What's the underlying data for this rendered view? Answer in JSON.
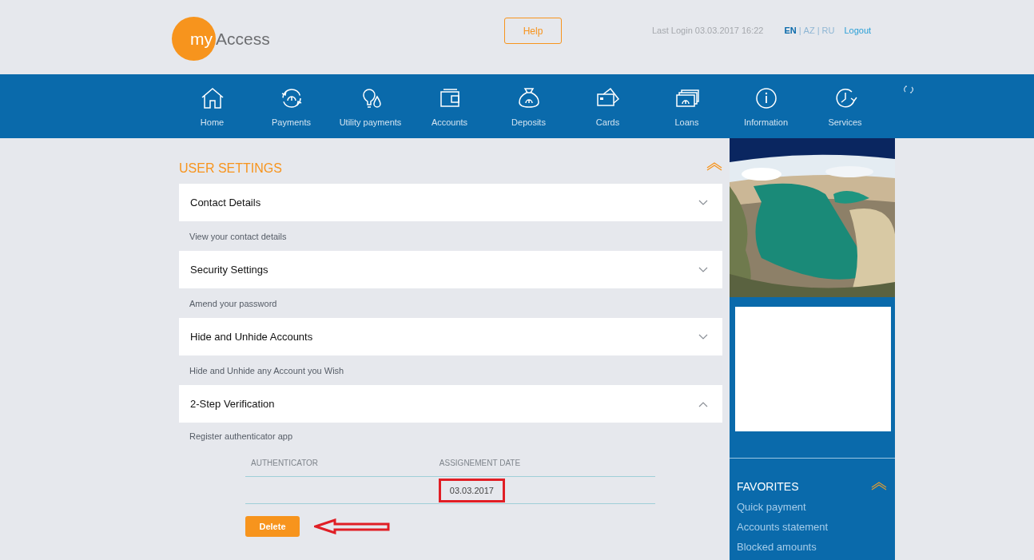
{
  "header": {
    "logo": {
      "prefix": "my",
      "name": "Access"
    },
    "help_button": "Help",
    "last_login": "Last Login 03.03.2017 16:22",
    "languages": {
      "separator": "|",
      "items": [
        {
          "label": "EN",
          "selected": true
        },
        {
          "label": "AZ",
          "selected": false
        },
        {
          "label": "RU",
          "selected": false
        }
      ]
    },
    "logout": "Logout"
  },
  "nav": {
    "items": [
      {
        "label": "Home"
      },
      {
        "label": "Payments"
      },
      {
        "label": "Utility payments"
      },
      {
        "label": "Accounts"
      },
      {
        "label": "Deposits"
      },
      {
        "label": "Cards"
      },
      {
        "label": "Loans"
      },
      {
        "label": "Information"
      },
      {
        "label": "Services"
      }
    ]
  },
  "user_settings": {
    "title": "USER SETTINGS",
    "expanded": true,
    "sections": [
      {
        "title": "Contact Details",
        "description": "View your contact details",
        "expanded": false
      },
      {
        "title": "Security Settings",
        "description": "Amend your password",
        "expanded": false
      },
      {
        "title": "Hide and Unhide Accounts",
        "description": "Hide and Unhide any Account you Wish",
        "expanded": false
      },
      {
        "title": "2-Step Verification",
        "description": "Register authenticator app",
        "expanded": true,
        "table": {
          "columns": [
            "AUTHENTICATOR",
            "ASSIGNEMENT DATE"
          ],
          "rows": [
            {
              "assignment_date": "03.03.2017"
            }
          ]
        },
        "button": "Delete"
      }
    ]
  },
  "favorites": {
    "title": "FAVORITES",
    "expanded": true,
    "links": [
      "Quick payment",
      "Accounts statement",
      "Blocked amounts"
    ]
  }
}
